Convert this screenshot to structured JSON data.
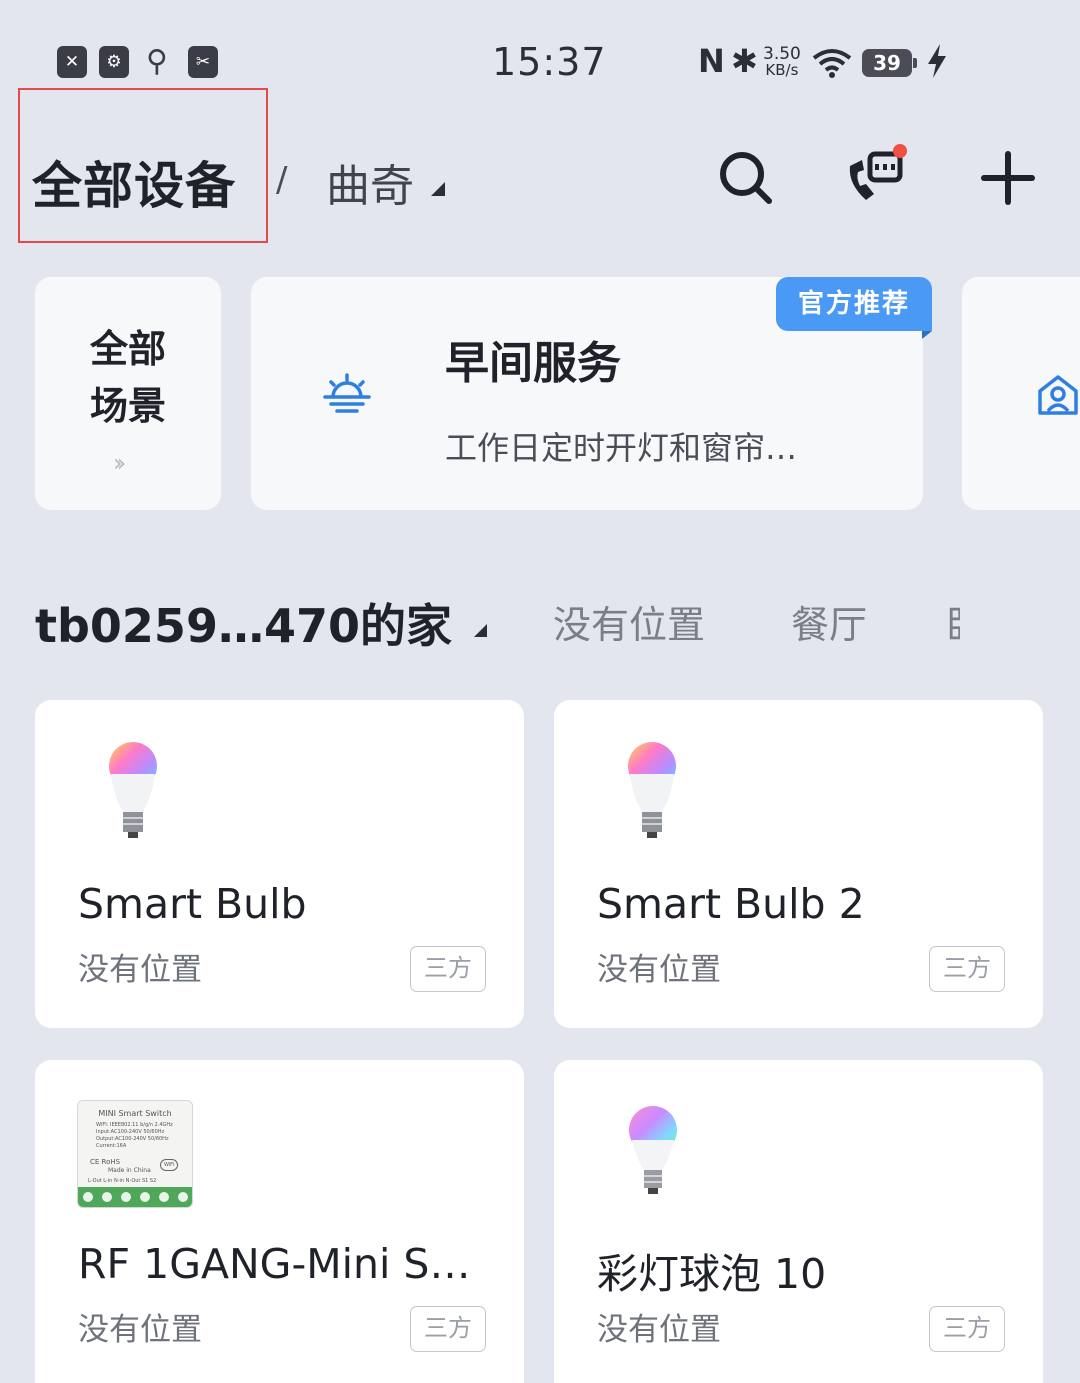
{
  "status_bar": {
    "time": "15:37",
    "left_icons": [
      "sim-off-icon",
      "usb-settings-icon",
      "usb-icon",
      "screenshot-icon"
    ],
    "net_speed_value": "3.50",
    "net_speed_unit": "KB/s",
    "nfc_glyph": "N",
    "bluetooth_glyph": "✱",
    "battery": "39"
  },
  "header": {
    "title": "全部设备",
    "separator": "/",
    "home_name": "曲奇"
  },
  "scenes": {
    "all_line1": "全部",
    "all_line2": "场景",
    "all_arrows": "››",
    "featured_title": "早间服务",
    "featured_desc": "工作日定时开灯和窗帘…",
    "badge": "官方推荐"
  },
  "home_bar": {
    "home": "tb0259…470的家",
    "rooms": [
      "没有位置",
      "餐厅",
      "卧"
    ]
  },
  "devices": [
    {
      "name": "Smart Bulb",
      "location": "没有位置",
      "tag": "三方"
    },
    {
      "name": "Smart Bulb  2",
      "location": "没有位置",
      "tag": "三方"
    },
    {
      "name": "RF 1GANG-Mini S…",
      "location": "没有位置",
      "tag": "三方"
    },
    {
      "name": "彩灯球泡 10",
      "location": "没有位置",
      "tag": "三方"
    }
  ],
  "switch_label": {
    "brand_line": "MINI   Smart   Switch",
    "spec_lines": [
      "WIFI: IEEE802.11 b/g/n 2.4GHz",
      "Input:AC100-240V 50/60Hz",
      "Output:AC100-240V 50/60Hz",
      "Current:16A"
    ],
    "cert": "CE          RoHS",
    "origin": "Made  in  China",
    "terminals": "L-Out L-in   N-in N-Out   S1   S2",
    "wifi_mark": "WiFi"
  },
  "colors": {
    "accent": "#4a9af5",
    "notification": "#f04f43",
    "highlight": "#e5484d"
  }
}
